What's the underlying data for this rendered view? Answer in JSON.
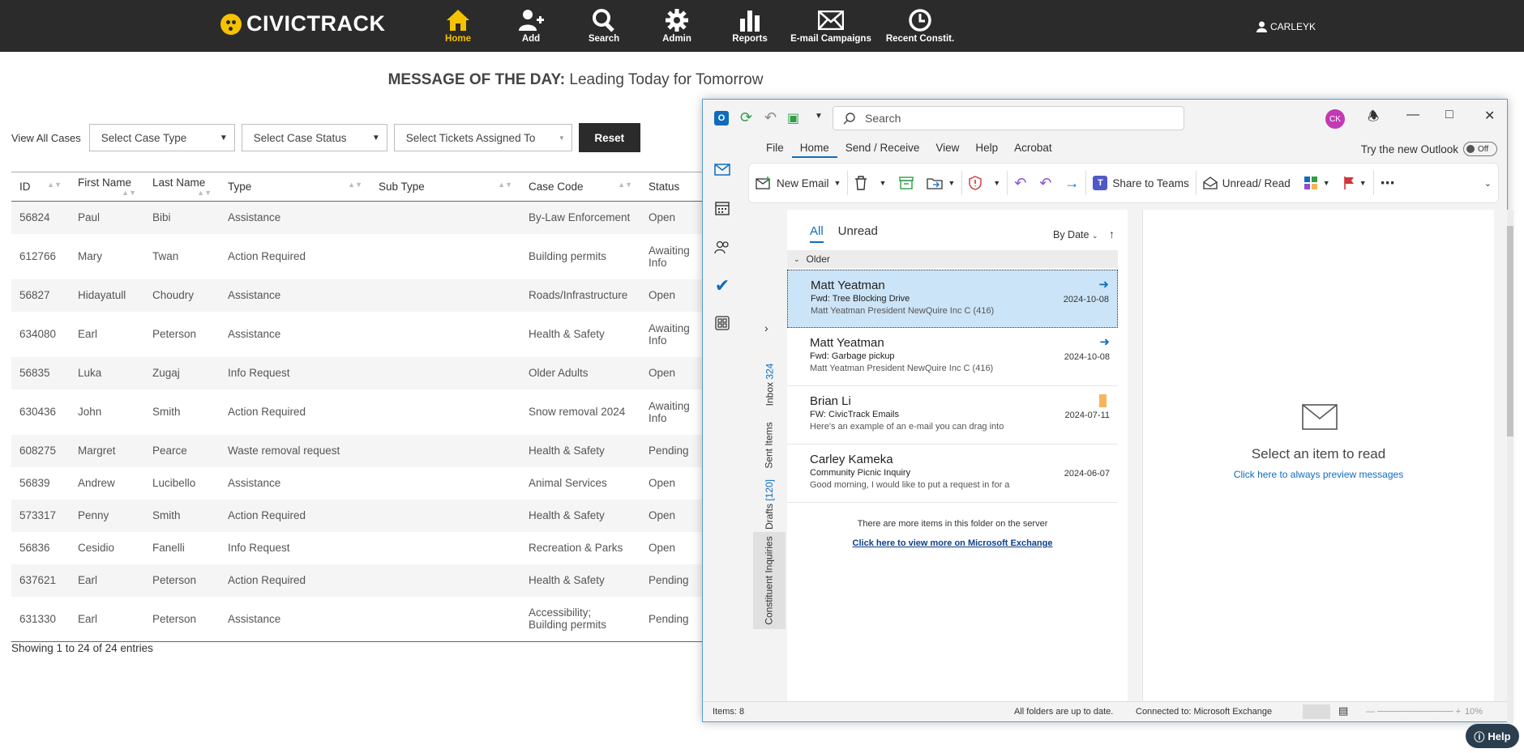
{
  "app": {
    "logo_text": "CIVICTRACK",
    "user": "CARLEYK",
    "nav": [
      {
        "label": "Home",
        "icon": "home-icon"
      },
      {
        "label": "Add",
        "icon": "add-user-icon"
      },
      {
        "label": "Search",
        "icon": "search-icon"
      },
      {
        "label": "Admin",
        "icon": "gear-icon"
      },
      {
        "label": "Reports",
        "icon": "bar-chart-icon"
      },
      {
        "label": "E-mail Campaigns",
        "icon": "envelope-icon"
      },
      {
        "label": "Recent Constit.",
        "icon": "clock-icon"
      }
    ],
    "active_color": "#f5c200"
  },
  "motd": {
    "prefix": "MESSAGE OF THE DAY:",
    "text": " Leading Today for Tomorrow"
  },
  "filters": {
    "label": "View All Cases",
    "case_type": "Select Case Type",
    "case_status": "Select Case Status",
    "assigned_to": "Select Tickets Assigned To",
    "reset": "Reset"
  },
  "table": {
    "headers": [
      "ID",
      "First Name",
      "Last Name",
      "Type",
      "Sub Type",
      "Case Code",
      "Status"
    ],
    "rows": [
      [
        "56824",
        "Paul",
        "Bibi",
        "Assistance",
        "",
        "By-Law Enforcement",
        "Open"
      ],
      [
        "612766",
        "Mary",
        "Twan",
        "Action Required",
        "",
        "Building permits",
        "Awaiting Info"
      ],
      [
        "56827",
        "Hidayatull",
        "Choudry",
        "Assistance",
        "",
        "Roads/Infrastructure",
        "Open"
      ],
      [
        "634080",
        "Earl",
        "Peterson",
        "Assistance",
        "",
        "Health & Safety",
        "Awaiting Info"
      ],
      [
        "56835",
        "Luka",
        "Zugaj",
        "Info Request",
        "",
        "Older Adults",
        "Open"
      ],
      [
        "630436",
        "John",
        "Smith",
        "Action Required",
        "",
        "Snow removal 2024",
        "Awaiting Info"
      ],
      [
        "608275",
        "Margret",
        "Pearce",
        "Waste removal request",
        "",
        "Health & Safety",
        "Pending"
      ],
      [
        "56839",
        "Andrew",
        "Lucibello",
        "Assistance",
        "",
        "Animal Services",
        "Open"
      ],
      [
        "573317",
        "Penny",
        "Smith",
        "Action Required",
        "",
        "Health & Safety",
        "Open"
      ],
      [
        "56836",
        "Cesidio",
        "Fanelli",
        "Info Request",
        "",
        "Recreation & Parks",
        "Open"
      ],
      [
        "637621",
        "Earl",
        "Peterson",
        "Action Required",
        "",
        "Health & Safety",
        "Pending"
      ],
      [
        "631330",
        "Earl",
        "Peterson",
        "Assistance",
        "",
        "Accessibility; Building permits",
        "Pending"
      ]
    ],
    "showing": "Showing 1 to 24 of 24 entries"
  },
  "outlook": {
    "search_placeholder": "Search",
    "avatar_initials": "CK",
    "menu": [
      "File",
      "Home",
      "Send / Receive",
      "View",
      "Help",
      "Acrobat"
    ],
    "try_new": "Try the new Outlook",
    "toggle_state": "Off",
    "ribbon": {
      "new_email": "New Email",
      "share_teams": "Share to Teams",
      "unread_read": "Unread/ Read"
    },
    "folders": [
      {
        "name": "Inbox",
        "count": "324"
      },
      {
        "name": "Sent Items",
        "count": ""
      },
      {
        "name": "Drafts",
        "count": "[120]"
      },
      {
        "name": "Constituent Inquiries",
        "count": ""
      }
    ],
    "tabs": {
      "all": "All",
      "unread": "Unread",
      "sort": "By Date"
    },
    "group": "Older",
    "messages": [
      {
        "from": "Matt Yeatman",
        "subject": "Fwd: Tree Blocking Drive",
        "preview": "Matt Yeatman  President  NewQuire Inc  C  (416)",
        "date": "2024-10-08",
        "marker": "forward"
      },
      {
        "from": "Matt Yeatman",
        "subject": "Fwd: Garbage pickup",
        "preview": "Matt Yeatman  President  NewQuire Inc  C  (416)",
        "date": "2024-10-08",
        "marker": "forward"
      },
      {
        "from": "Brian Li",
        "subject": "FW: CivicTrack Emails",
        "preview": "Here's an example of an e-mail you can drag into",
        "date": "2024-07-11",
        "marker": "flag"
      },
      {
        "from": "Carley Kameka",
        "subject": "Community Picnic Inquiry",
        "preview": "Good morning,  I would like to put a request in for a",
        "date": "2024-06-07",
        "marker": ""
      }
    ],
    "more_server": "There are more items in this folder on the server",
    "more_link": "Click here to view more on Microsoft Exchange",
    "reading": {
      "title": "Select an item to read",
      "link": "Click here to always preview messages"
    },
    "status": {
      "items": "Items: 8",
      "sync": "All folders are up to date.",
      "connected": "Connected to: Microsoft Exchange",
      "zoom": "10%"
    }
  },
  "help": {
    "label": "Help"
  }
}
